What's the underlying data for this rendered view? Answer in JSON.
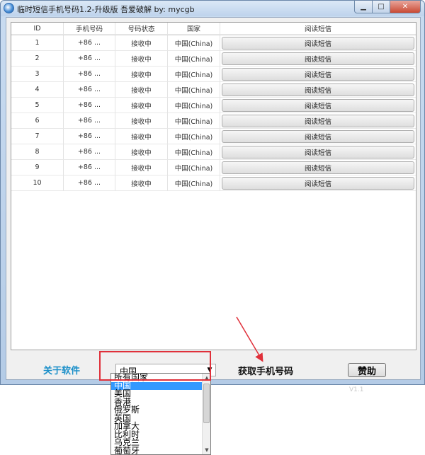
{
  "window": {
    "title": "临时短信手机号码1.2-升级版 吾爱破解 by: mycgb",
    "minimize_label": "▁",
    "maximize_label": "□",
    "close_label": "✕"
  },
  "table": {
    "columns": [
      "ID",
      "手机号码",
      "号码状态",
      "国家",
      "阅读短信"
    ],
    "rows": [
      {
        "id": "1",
        "phone": "+86 ...",
        "status": "接收中",
        "country": "中国(China)",
        "action": "阅读短信"
      },
      {
        "id": "2",
        "phone": "+86 ...",
        "status": "接收中",
        "country": "中国(China)",
        "action": "阅读短信"
      },
      {
        "id": "3",
        "phone": "+86 ...",
        "status": "接收中",
        "country": "中国(China)",
        "action": "阅读短信"
      },
      {
        "id": "4",
        "phone": "+86 ...",
        "status": "接收中",
        "country": "中国(China)",
        "action": "阅读短信"
      },
      {
        "id": "5",
        "phone": "+86 ...",
        "status": "接收中",
        "country": "中国(China)",
        "action": "阅读短信"
      },
      {
        "id": "6",
        "phone": "+86 ...",
        "status": "接收中",
        "country": "中国(China)",
        "action": "阅读短信"
      },
      {
        "id": "7",
        "phone": "+86 ...",
        "status": "接收中",
        "country": "中国(China)",
        "action": "阅读短信"
      },
      {
        "id": "8",
        "phone": "+86 ...",
        "status": "接收中",
        "country": "中国(China)",
        "action": "阅读短信"
      },
      {
        "id": "9",
        "phone": "+86 ...",
        "status": "接收中",
        "country": "中国(China)",
        "action": "阅读短信"
      },
      {
        "id": "10",
        "phone": "+86 ...",
        "status": "接收中",
        "country": "中国(China)",
        "action": "阅读短信"
      }
    ]
  },
  "footer": {
    "about_label": "关于软件",
    "country_select_value": "中国",
    "get_phone_label": "获取手机号码",
    "sponsor_label": "赞助"
  },
  "dropdown": {
    "options": [
      "所有国家",
      "中国",
      "美国",
      "香港",
      "俄罗斯",
      "英国",
      "加拿大",
      "比利时",
      "乌克兰",
      "葡萄牙"
    ],
    "selected_index": 1
  },
  "colors": {
    "about_link": "#1a8fc9",
    "annotation_red": "#e0303a",
    "selection": "#3399ff"
  },
  "background_text": "V1.1"
}
